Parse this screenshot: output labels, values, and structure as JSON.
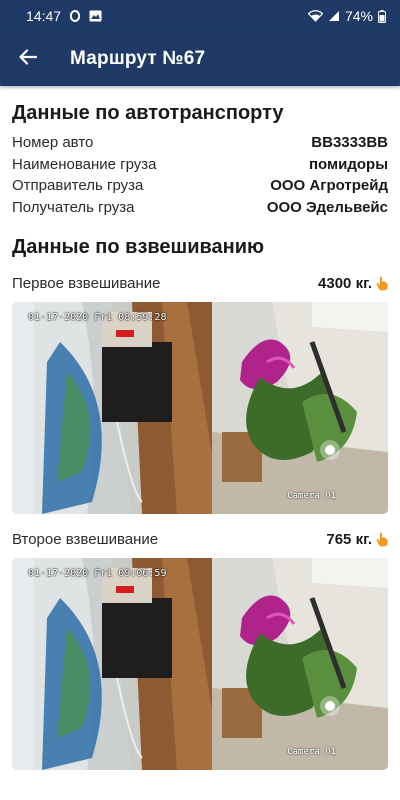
{
  "status_bar": {
    "time": "14:47",
    "battery": "74%",
    "icons": [
      "opera-icon",
      "gallery-icon",
      "wifi-icon",
      "signal-icon",
      "battery-icon"
    ]
  },
  "header": {
    "back_icon": "arrow-left-icon",
    "title": "Маршрут №67"
  },
  "colors": {
    "primary": "#1f3a67",
    "accent_hand": "#f39a1e"
  },
  "transport": {
    "title": "Данные по автотранспорту",
    "rows": [
      {
        "label": "Номер авто",
        "value": "ВВ3333ВВ"
      },
      {
        "label": "Наименование груза",
        "value": "помидоры"
      },
      {
        "label": "Отправитель груза",
        "value": "ООО Агротрейд"
      },
      {
        "label": "Получатель груза",
        "value": "ООО Эдельвейс"
      }
    ]
  },
  "weighing": {
    "title": "Данные по взвешиванию",
    "items": [
      {
        "label": "Первое взвешивание",
        "value": "4300 кг.",
        "icon": "hand-pointer-icon",
        "camera": {
          "timestamp": "01-17-2020 Fri 08:59:28",
          "label": "Camera 01"
        }
      },
      {
        "label": "Второе взвешивание",
        "value": "765 кг.",
        "icon": "hand-pointer-icon",
        "camera": {
          "timestamp": "01-17-2020 Fri 09:06:59",
          "label": "Camera 01"
        }
      }
    ]
  }
}
